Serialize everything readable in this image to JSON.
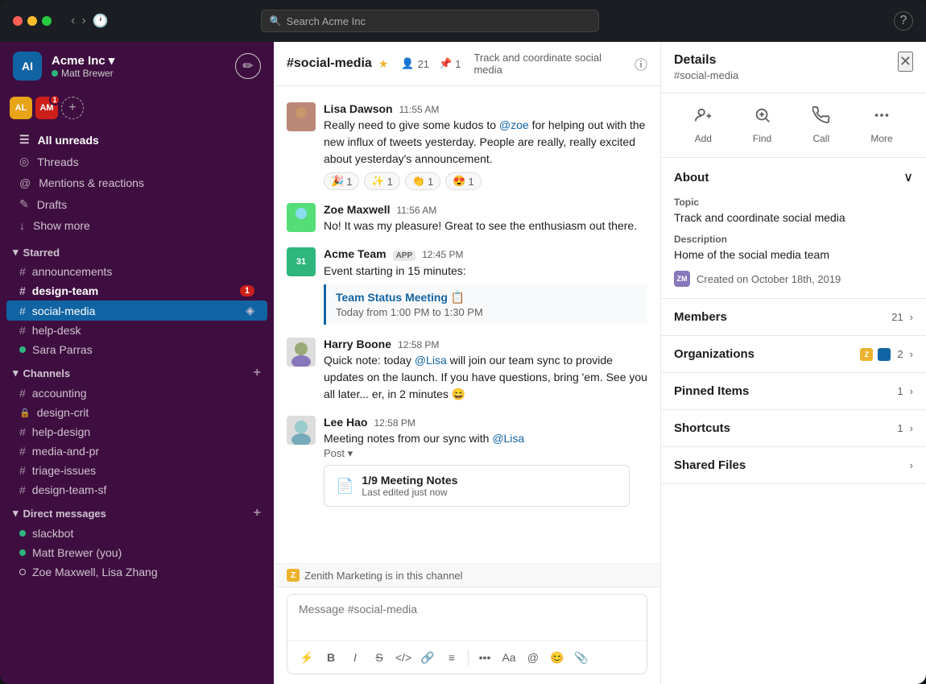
{
  "titlebar": {
    "search_placeholder": "Search Acme Inc"
  },
  "sidebar": {
    "workspace_name": "Acme Inc",
    "workspace_chevron": "▾",
    "user_name": "Matt Brewer",
    "nav_items": [
      {
        "id": "all-unreads",
        "label": "All unreads",
        "icon": "☰"
      },
      {
        "id": "threads",
        "label": "Threads",
        "icon": "⊕"
      },
      {
        "id": "mentions",
        "label": "Mentions & reactions",
        "icon": "@"
      },
      {
        "id": "drafts",
        "label": "Drafts",
        "icon": "✎"
      },
      {
        "id": "show-more",
        "label": "Show more",
        "icon": "↓"
      }
    ],
    "starred_section": "Starred",
    "starred_channels": [
      {
        "name": "announcements",
        "prefix": "#"
      },
      {
        "name": "design-team",
        "prefix": "#",
        "badge": "1"
      },
      {
        "name": "social-media",
        "prefix": "#",
        "active": true
      },
      {
        "name": "help-desk",
        "prefix": "#"
      },
      {
        "name": "Sara Parras",
        "prefix": "●",
        "is_dm": true
      }
    ],
    "channels_section": "Channels",
    "channels": [
      {
        "name": "accounting",
        "prefix": "#"
      },
      {
        "name": "design-crit",
        "prefix": "🔒"
      },
      {
        "name": "help-design",
        "prefix": "#"
      },
      {
        "name": "media-and-pr",
        "prefix": "#"
      },
      {
        "name": "triage-issues",
        "prefix": "#"
      },
      {
        "name": "design-team-sf",
        "prefix": "#"
      }
    ],
    "dm_section": "Direct messages",
    "dms": [
      {
        "name": "slackbot",
        "online": true
      },
      {
        "name": "Matt Brewer (you)",
        "online": true
      },
      {
        "name": "Zoe Maxwell, Lisa Zhang",
        "type": "group"
      }
    ]
  },
  "chat": {
    "channel_name": "#social-media",
    "channel_topic": "Track and coordinate social media",
    "member_count": "21",
    "pinned_count": "1",
    "messages": [
      {
        "id": "msg1",
        "author": "Lisa Dawson",
        "time": "11:55 AM",
        "text": "Really need to give some kudos to @zoe for helping out with the new influx of tweets yesterday. People are really, really excited about yesterday's announcement.",
        "reactions": [
          {
            "emoji": "🎉",
            "count": "1"
          },
          {
            "emoji": "✨",
            "count": "1"
          },
          {
            "emoji": "👏",
            "count": "1"
          },
          {
            "emoji": "😍",
            "count": "1"
          }
        ]
      },
      {
        "id": "msg2",
        "author": "Zoe Maxwell",
        "time": "11:56 AM",
        "text": "No! It was my pleasure! Great to see the enthusiasm out there.",
        "reactions": []
      },
      {
        "id": "msg3",
        "author": "Acme Team",
        "app": "APP",
        "time": "12:45 PM",
        "text": "Event starting in 15 minutes:",
        "event_title": "Team Status Meeting 📋",
        "event_time": "Today from 1:00 PM to 1:30 PM",
        "reactions": []
      },
      {
        "id": "msg4",
        "author": "Harry Boone",
        "time": "12:58 PM",
        "text": "Quick note: today @Lisa will join our team sync to provide updates on the launch. If you have questions, bring 'em. See you all later... er, in 2 minutes 😄",
        "reactions": []
      },
      {
        "id": "msg5",
        "author": "Lee Hao",
        "time": "12:58 PM",
        "text": "Meeting notes from our sync with @Lisa",
        "post_label": "Post",
        "post_title": "1/9 Meeting Notes",
        "post_meta": "Last edited just now",
        "reactions": []
      }
    ],
    "zenith_banner": "Zenith Marketing is in this channel",
    "input_placeholder": "Message #social-media"
  },
  "details": {
    "panel_title": "Details",
    "panel_subtitle": "#social-media",
    "actions": [
      {
        "id": "add",
        "label": "Add",
        "icon": "👤+"
      },
      {
        "id": "find",
        "label": "Find",
        "icon": "🔍"
      },
      {
        "id": "call",
        "label": "Call",
        "icon": "📞"
      },
      {
        "id": "more",
        "label": "More",
        "icon": "•••"
      }
    ],
    "about_section": "About",
    "topic_label": "Topic",
    "topic_value": "Track and coordinate social media",
    "description_label": "Description",
    "description_value": "Home of the social media team",
    "created_label": "Created on October 18th, 2019",
    "members_section": "Members",
    "members_count": "21",
    "organizations_section": "Organizations",
    "organizations_count": "2",
    "pinned_section": "Pinned Items",
    "pinned_count": "1",
    "shortcuts_section": "Shortcuts",
    "shortcuts_count": "1",
    "shared_files_section": "Shared Files"
  }
}
